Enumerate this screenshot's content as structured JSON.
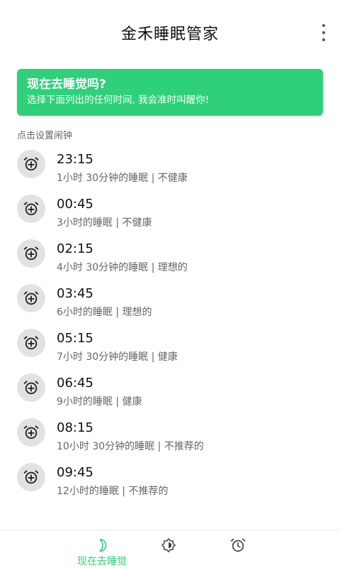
{
  "header": {
    "title": "金禾睡眠管家",
    "menu_icon": "more-vertical-icon"
  },
  "banner": {
    "title": "现在去睡觉吗?",
    "subtitle": "选择下面列出的任何时间, 我会准时叫醒你!",
    "color": "#2fd07a"
  },
  "hint": "点击设置闹钟",
  "alarms": [
    {
      "time": "23:15",
      "desc": "1小时 30分钟的睡眠 | 不健康"
    },
    {
      "time": "00:45",
      "desc": "3小时的睡眠 | 不健康"
    },
    {
      "time": "02:15",
      "desc": "4小时 30分钟的睡眠 | 理想的"
    },
    {
      "time": "03:45",
      "desc": "6小时的睡眠 | 理想的"
    },
    {
      "time": "05:15",
      "desc": "7小时 30分钟的睡眠 | 健康"
    },
    {
      "time": "06:45",
      "desc": "9小时的睡眠 | 健康"
    },
    {
      "time": "08:15",
      "desc": "10小时 30分钟的睡眠 | 不推荐的"
    },
    {
      "time": "09:45",
      "desc": "12小时的睡眠 | 不推荐的"
    }
  ],
  "bottom_nav": {
    "tabs": [
      {
        "label": "现在去睡觉",
        "icon": "moon-icon",
        "active": true
      },
      {
        "label": "",
        "icon": "brightness-icon",
        "active": false
      },
      {
        "label": "",
        "icon": "alarm-clock-icon",
        "active": false
      }
    ],
    "active_color": "#2fd07a"
  }
}
